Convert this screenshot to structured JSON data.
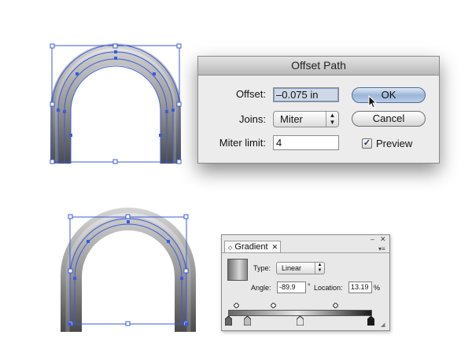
{
  "offset_dialog": {
    "title": "Offset Path",
    "offset_label": "Offset:",
    "offset_value": "–0.075 in",
    "joins_label": "Joins:",
    "joins_value": "Miter",
    "miter_label": "Miter limit:",
    "miter_value": "4",
    "ok_label": "OK",
    "cancel_label": "Cancel",
    "preview_label": "Preview",
    "preview_checked": true
  },
  "gradient_panel": {
    "tab_label": "Gradient",
    "close_glyph": "✕",
    "type_label": "Type:",
    "type_value": "Linear",
    "angle_label": "Angle:",
    "angle_value": "-89.9",
    "degree_symbol": "°",
    "location_label": "Location:",
    "location_value": "13.19",
    "percent_symbol": "%",
    "gradient_colors": [
      "#666666",
      "#e6e6e6",
      "#1a1a1a"
    ]
  },
  "colors": {
    "selection": "#3b5bdb",
    "default_button": "#9bb6d8"
  }
}
